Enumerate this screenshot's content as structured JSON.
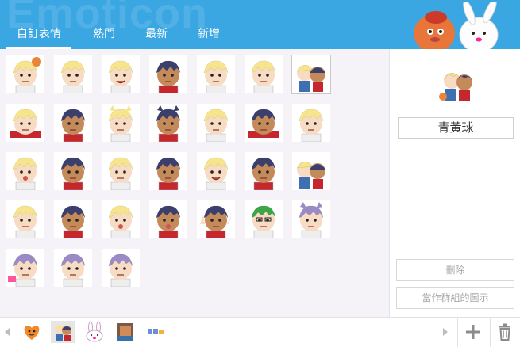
{
  "header": {
    "watermark": "Emoticon",
    "tabs": [
      {
        "label": "自訂表情",
        "active": true
      },
      {
        "label": "熱門",
        "active": false
      },
      {
        "label": "最新",
        "active": false
      },
      {
        "label": "新增",
        "active": false
      }
    ]
  },
  "side_panel": {
    "selected_name": "青黃球",
    "delete_label": "刪除",
    "set_group_icon_label": "當作群組的圖示"
  },
  "emoticons": [
    "blonde-ball",
    "dark-scowl",
    "blonde-smile",
    "navy-sweat",
    "blonde-blank",
    "dark-frown",
    "pair-ball",
    "blonde-lying",
    "navy-sleepy",
    "blonde-cat",
    "navy-cat",
    "blonde-peek",
    "navy-lying",
    "blonde-wall",
    "blonde-cry",
    "navy-smirk",
    "blonde-calm",
    "navy-tired",
    "blonde-happy",
    "navy-angry",
    "pair-tease",
    "blonde-blush",
    "navy-annoyed",
    "blonde-cry-2",
    "navy-shock",
    "navy-victory",
    "green-glasses",
    "purple-cat",
    "purple-cake",
    "purple-sit",
    "purple-red-pair"
  ],
  "bottom_bar": {
    "packs": [
      "heart-face-icon",
      "character-pair-pack",
      "rabbit-pack",
      "photo-pack",
      "text-pack"
    ]
  },
  "colors": {
    "header_bg": "#3aa6e2",
    "grid_bg": "#f5f3f7",
    "blonde": "#f6e58a",
    "navy": "#3b3f6e",
    "skin": "#f7dcc3",
    "dark_skin": "#c58a5a"
  }
}
